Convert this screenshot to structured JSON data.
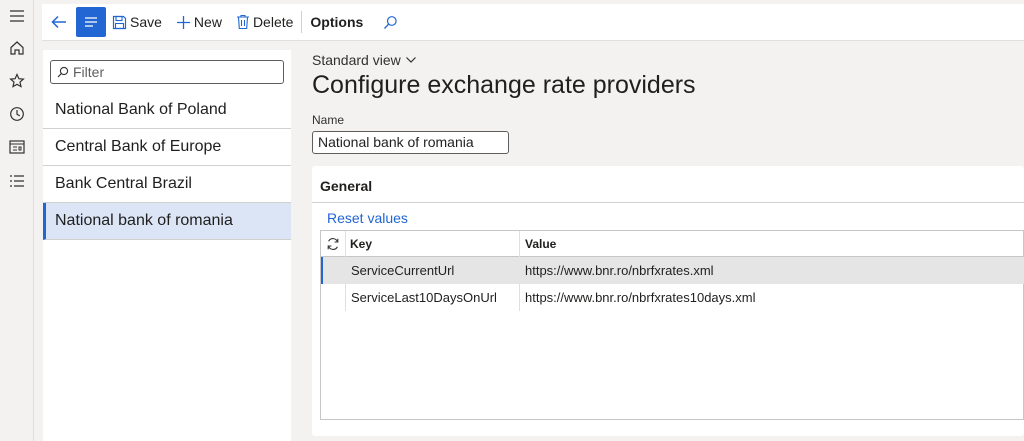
{
  "nav_rail": {
    "icons": [
      "hamburger-icon",
      "home-icon",
      "star-icon",
      "clock-icon",
      "workspace-icon",
      "list-icon"
    ]
  },
  "toolbar": {
    "save_label": "Save",
    "new_label": "New",
    "delete_label": "Delete",
    "options_label": "Options"
  },
  "filter": {
    "placeholder": "Filter"
  },
  "providers": [
    {
      "name": "National Bank of Poland",
      "selected": false
    },
    {
      "name": "Central Bank of Europe",
      "selected": false
    },
    {
      "name": "Bank Central Brazil",
      "selected": false
    },
    {
      "name": "National bank of romania",
      "selected": true
    }
  ],
  "main": {
    "view_selector": "Standard view",
    "page_title": "Configure exchange rate providers",
    "name_label": "Name",
    "name_value": "National bank of romania"
  },
  "general": {
    "title": "General",
    "reset_label": "Reset values",
    "columns": {
      "key": "Key",
      "value": "Value"
    },
    "rows": [
      {
        "key": "ServiceCurrentUrl",
        "value": "https://www.bnr.ro/nbrfxrates.xml",
        "selected": true
      },
      {
        "key": "ServiceLast10DaysOnUrl",
        "value": "https://www.bnr.ro/nbrfxrates10days.xml",
        "selected": false
      }
    ]
  },
  "colors": {
    "accent": "#2166d3",
    "selected_row": "#dbe5f6",
    "background": "#f3f2f1"
  }
}
